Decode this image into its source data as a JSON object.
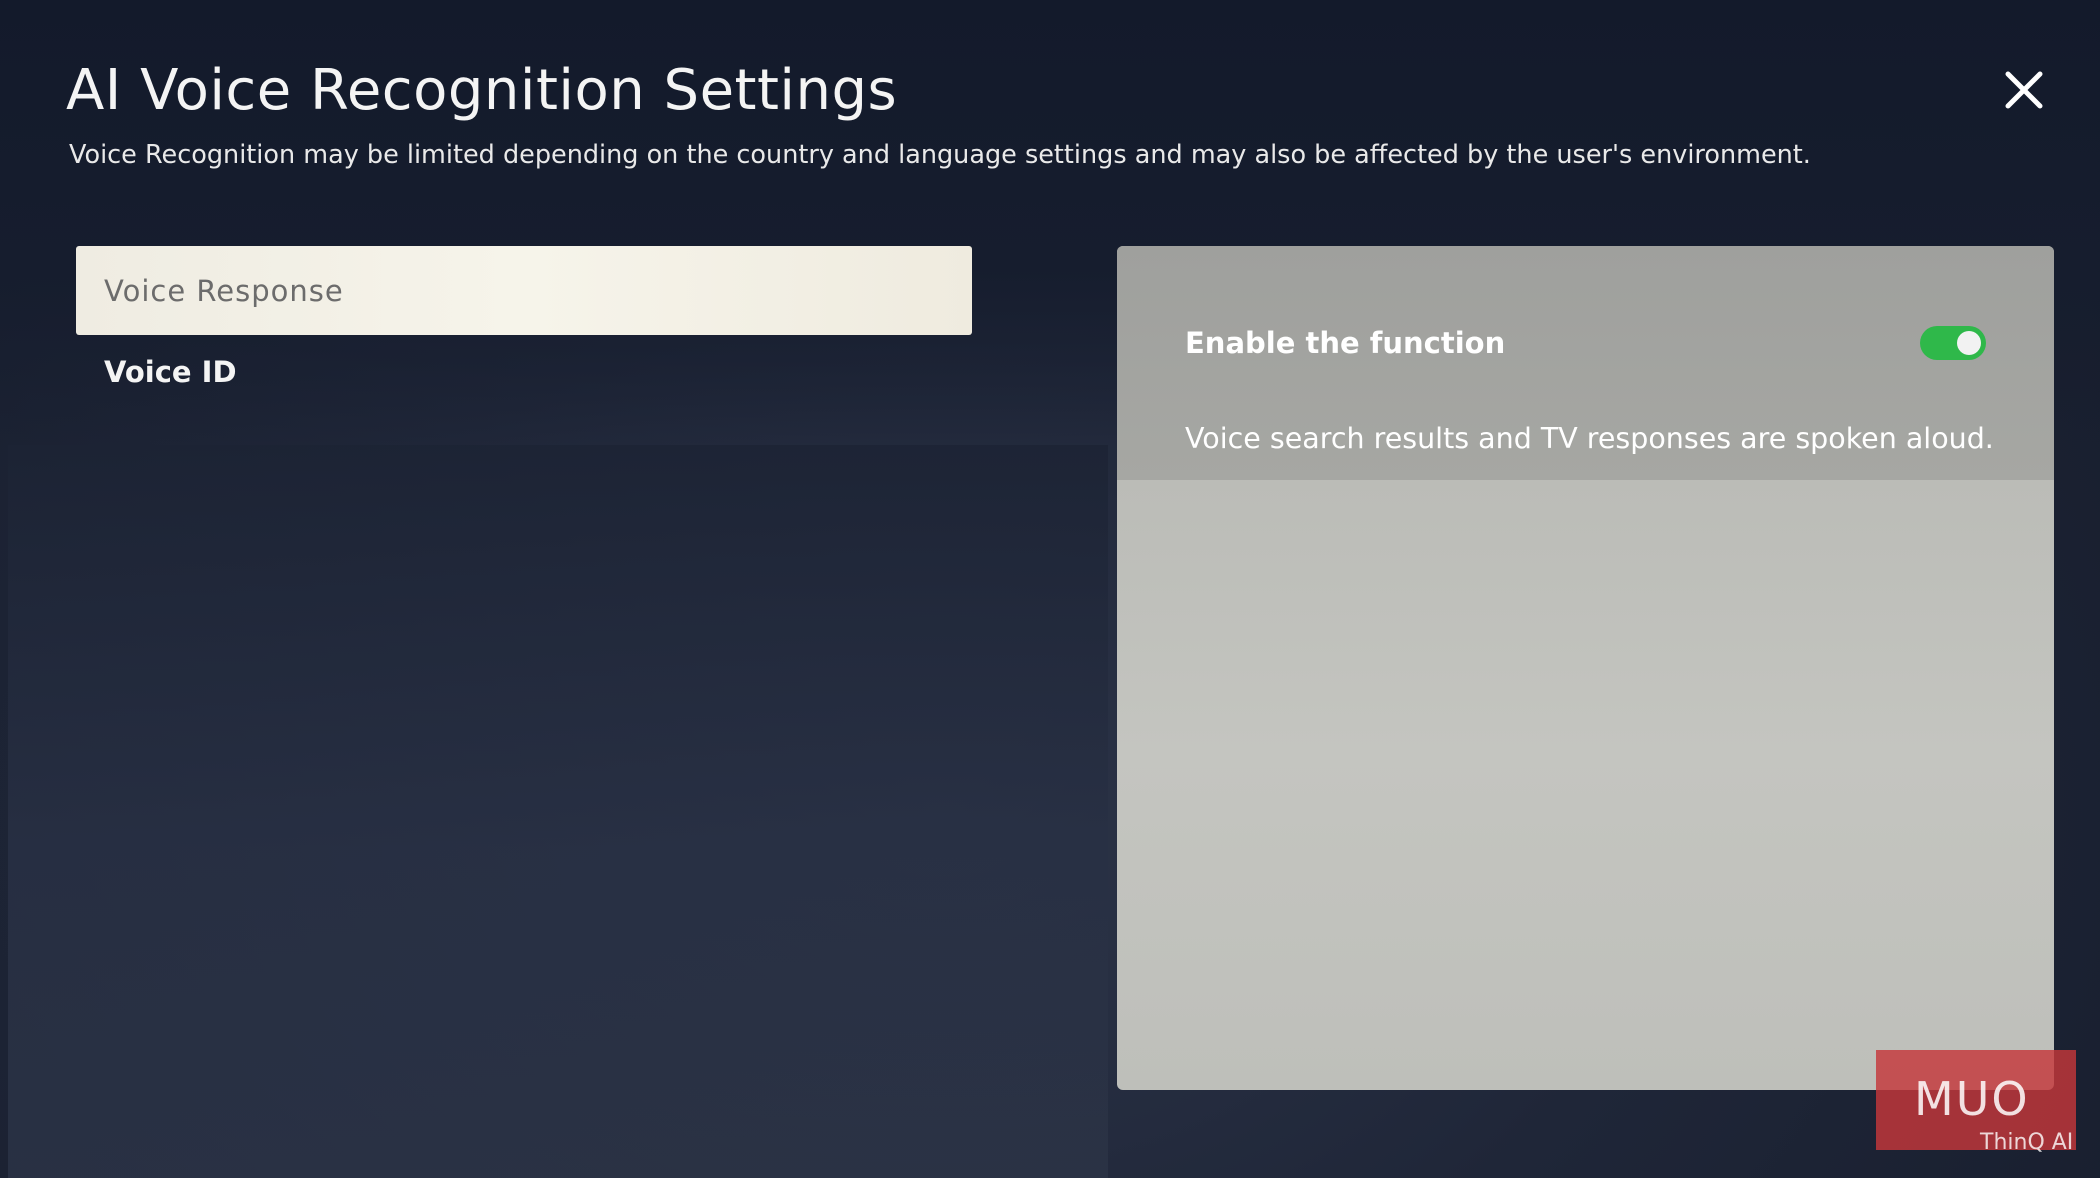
{
  "header": {
    "title": "AI Voice Recognition Settings",
    "subtitle": "Voice Recognition may be limited depending on the country and language settings and may also be affected by the user's environment."
  },
  "menu": {
    "items": [
      {
        "label": "Voice Response",
        "selected": true
      },
      {
        "label": "Voice ID",
        "selected": false
      }
    ]
  },
  "panel": {
    "toggle_label": "Enable the function",
    "toggle_state": "on",
    "description": "Voice search results and TV responses are spoken aloud."
  },
  "icons": {
    "close": "close-icon"
  },
  "colors": {
    "toggle_on": "#2fb84a",
    "selected_item_bg": "#f4f1e6",
    "watermark": "#c4373a"
  },
  "watermark": {
    "logo": "MUO",
    "brand": "ThinQ AI"
  }
}
